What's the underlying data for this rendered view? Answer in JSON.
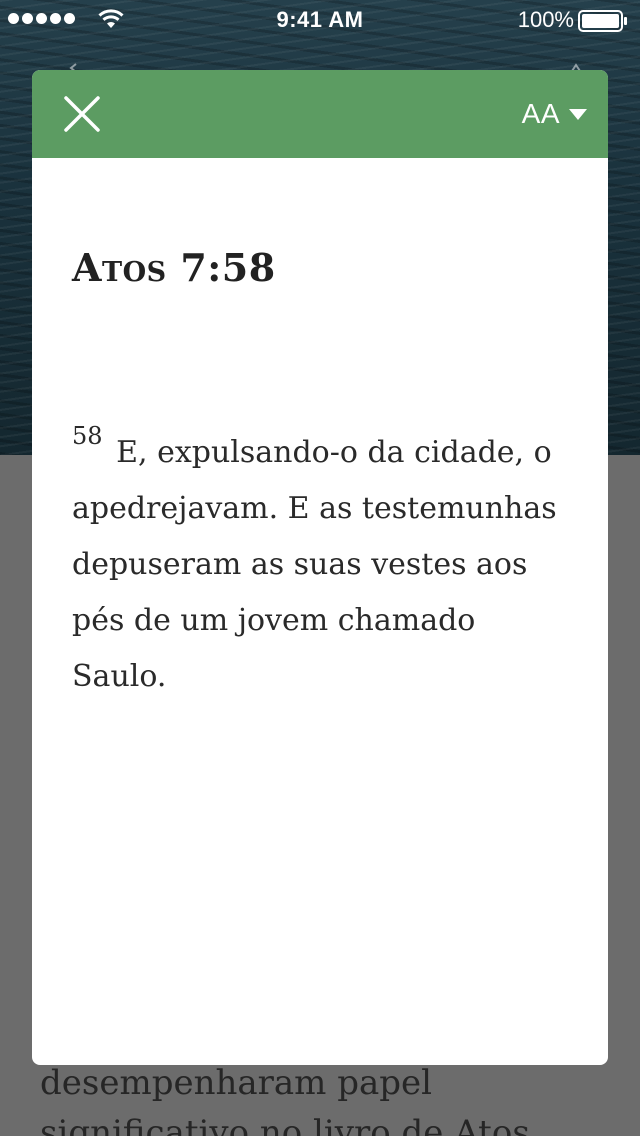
{
  "status_bar": {
    "time": "9:41 AM",
    "battery_percent": "100%",
    "signal_bars": 5,
    "icons": [
      "signal-dots-icon",
      "wifi-icon",
      "battery-icon"
    ]
  },
  "modal": {
    "header_color": "#5c9c62",
    "close_icon": "close-icon",
    "font_size_label": "AA",
    "font_size_icon": "caret-down-icon",
    "title": "Atos 7:58",
    "verse_number": "58",
    "verse_text": "E, expulsando-o da cidade, o apedrejavam. E as testemunhas depuseram as suas vestes aos pés de um jovem chamado Saulo."
  },
  "background": {
    "article_text_line1": "desempenharam papel",
    "article_text_line2": "significativo no livro de Atos"
  }
}
